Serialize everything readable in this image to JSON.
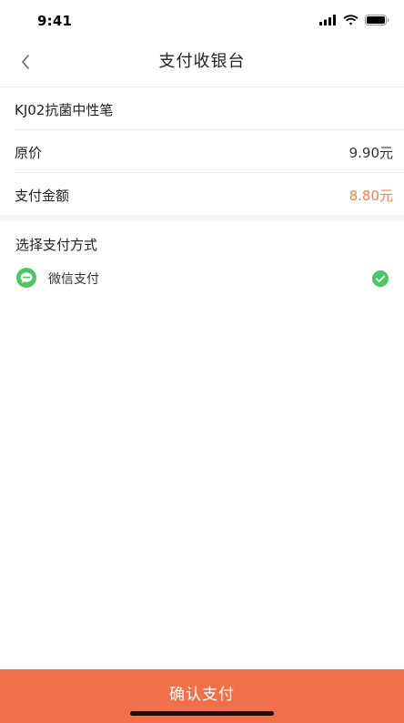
{
  "status_bar": {
    "time": "9:41"
  },
  "nav": {
    "title": "支付收银台"
  },
  "order": {
    "product_name": "KJ02抗菌中性笔",
    "original_price_label": "原价",
    "original_price_value": "9.90元",
    "pay_amount_label": "支付金额",
    "pay_amount_value": "8.80元"
  },
  "payment": {
    "heading": "选择支付方式",
    "methods": [
      {
        "label": "微信支付",
        "icon": "wechat-pay-icon",
        "selected": true
      }
    ]
  },
  "confirm": {
    "label": "确认支付"
  },
  "colors": {
    "accent": "#f0704b",
    "pay_amount": "#f4843f",
    "wechat_green": "#4cc660"
  }
}
